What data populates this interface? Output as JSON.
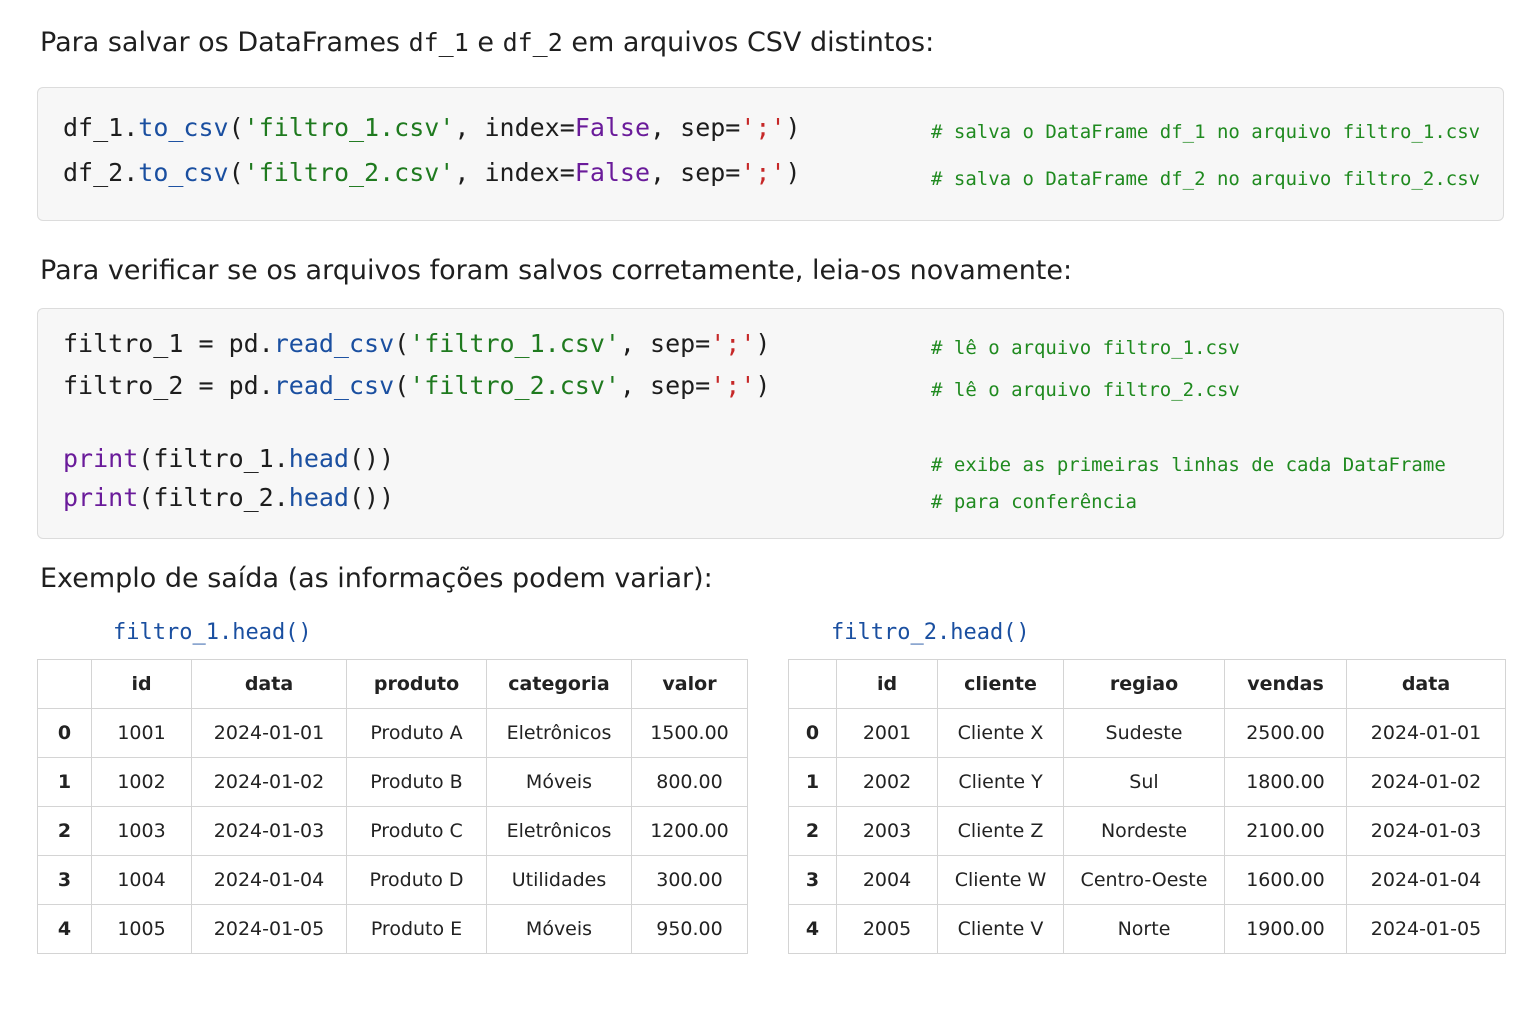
{
  "section1": {
    "text_before": "Para salvar os DataFrames ",
    "var1": "df_1",
    "conj": " e ",
    "var2": "df_2",
    "text_after": " em arquivos CSV distintos:"
  },
  "code1": {
    "lines": [
      {
        "obj": "df_1.",
        "fn": "to_csv",
        "open": "(",
        "str": "'filtro_1.csv'",
        "mid": ", index=",
        "kw": "False",
        "mid2": ", sep=",
        "sep": "';'",
        "close": ")",
        "comment": "# salva o DataFrame df_1 no arquivo filtro_1.csv"
      },
      {
        "obj": "df_2.",
        "fn": "to_csv",
        "open": "(",
        "str": "'filtro_2.csv'",
        "mid": ", index=",
        "kw": "False",
        "mid2": ", sep=",
        "sep": "';'",
        "close": ")",
        "comment": "# salva o DataFrame df_2 no arquivo filtro_2.csv"
      }
    ]
  },
  "section2": {
    "text": "Para verificar se os arquivos foram salvos corretamente, leia-os novamente:"
  },
  "code2": {
    "read_lines": [
      {
        "pre": "filtro_1 = pd.",
        "fn": "read_csv",
        "open": "(",
        "str": "'filtro_1.csv'",
        "mid": ", sep=",
        "sep": "';'",
        "close": ")",
        "comment": "# lê o arquivo filtro_1.csv"
      },
      {
        "pre": "filtro_2 = pd.",
        "fn": "read_csv",
        "open": "(",
        "str": "'filtro_2.csv'",
        "mid": ", sep=",
        "sep": "';'",
        "close": ")",
        "comment": "# lê o arquivo filtro_2.csv"
      }
    ],
    "print_lines": [
      {
        "kw": "print",
        "pre": "(filtro_1.",
        "fn": "head",
        "close": "())"
      },
      {
        "kw": "print",
        "pre": "(filtro_2.",
        "fn": "head",
        "close": "())"
      }
    ],
    "comment3": "# exibe as primeiras linhas de cada DataFrame",
    "comment4": "# para conferência"
  },
  "section3": {
    "text": "Exemplo de saída (as informações podem variar):"
  },
  "table1": {
    "caption": "filtro_1.head()",
    "columns": [
      "",
      "id",
      "data",
      "produto",
      "categoria",
      "valor"
    ],
    "rows": [
      [
        "0",
        "1001",
        "2024-01-01",
        "Produto A",
        "Eletrônicos",
        "1500.00"
      ],
      [
        "1",
        "1002",
        "2024-01-02",
        "Produto B",
        "Móveis",
        "800.00"
      ],
      [
        "2",
        "1003",
        "2024-01-03",
        "Produto C",
        "Eletrônicos",
        "1200.00"
      ],
      [
        "3",
        "1004",
        "2024-01-04",
        "Produto D",
        "Utilidades",
        "300.00"
      ],
      [
        "4",
        "1005",
        "2024-01-05",
        "Produto E",
        "Móveis",
        "950.00"
      ]
    ]
  },
  "table2": {
    "caption": "filtro_2.head()",
    "columns": [
      "",
      "id",
      "cliente",
      "regiao",
      "vendas",
      "data"
    ],
    "rows": [
      [
        "0",
        "2001",
        "Cliente X",
        "Sudeste",
        "2500.00",
        "2024-01-01"
      ],
      [
        "1",
        "2002",
        "Cliente Y",
        "Sul",
        "1800.00",
        "2024-01-02"
      ],
      [
        "2",
        "2003",
        "Cliente Z",
        "Nordeste",
        "2100.00",
        "2024-01-03"
      ],
      [
        "3",
        "2004",
        "Cliente W",
        "Centro-Oeste",
        "1600.00",
        "2024-01-04"
      ],
      [
        "4",
        "2005",
        "Cliente V",
        "Norte",
        "1900.00",
        "2024-01-05"
      ]
    ]
  }
}
